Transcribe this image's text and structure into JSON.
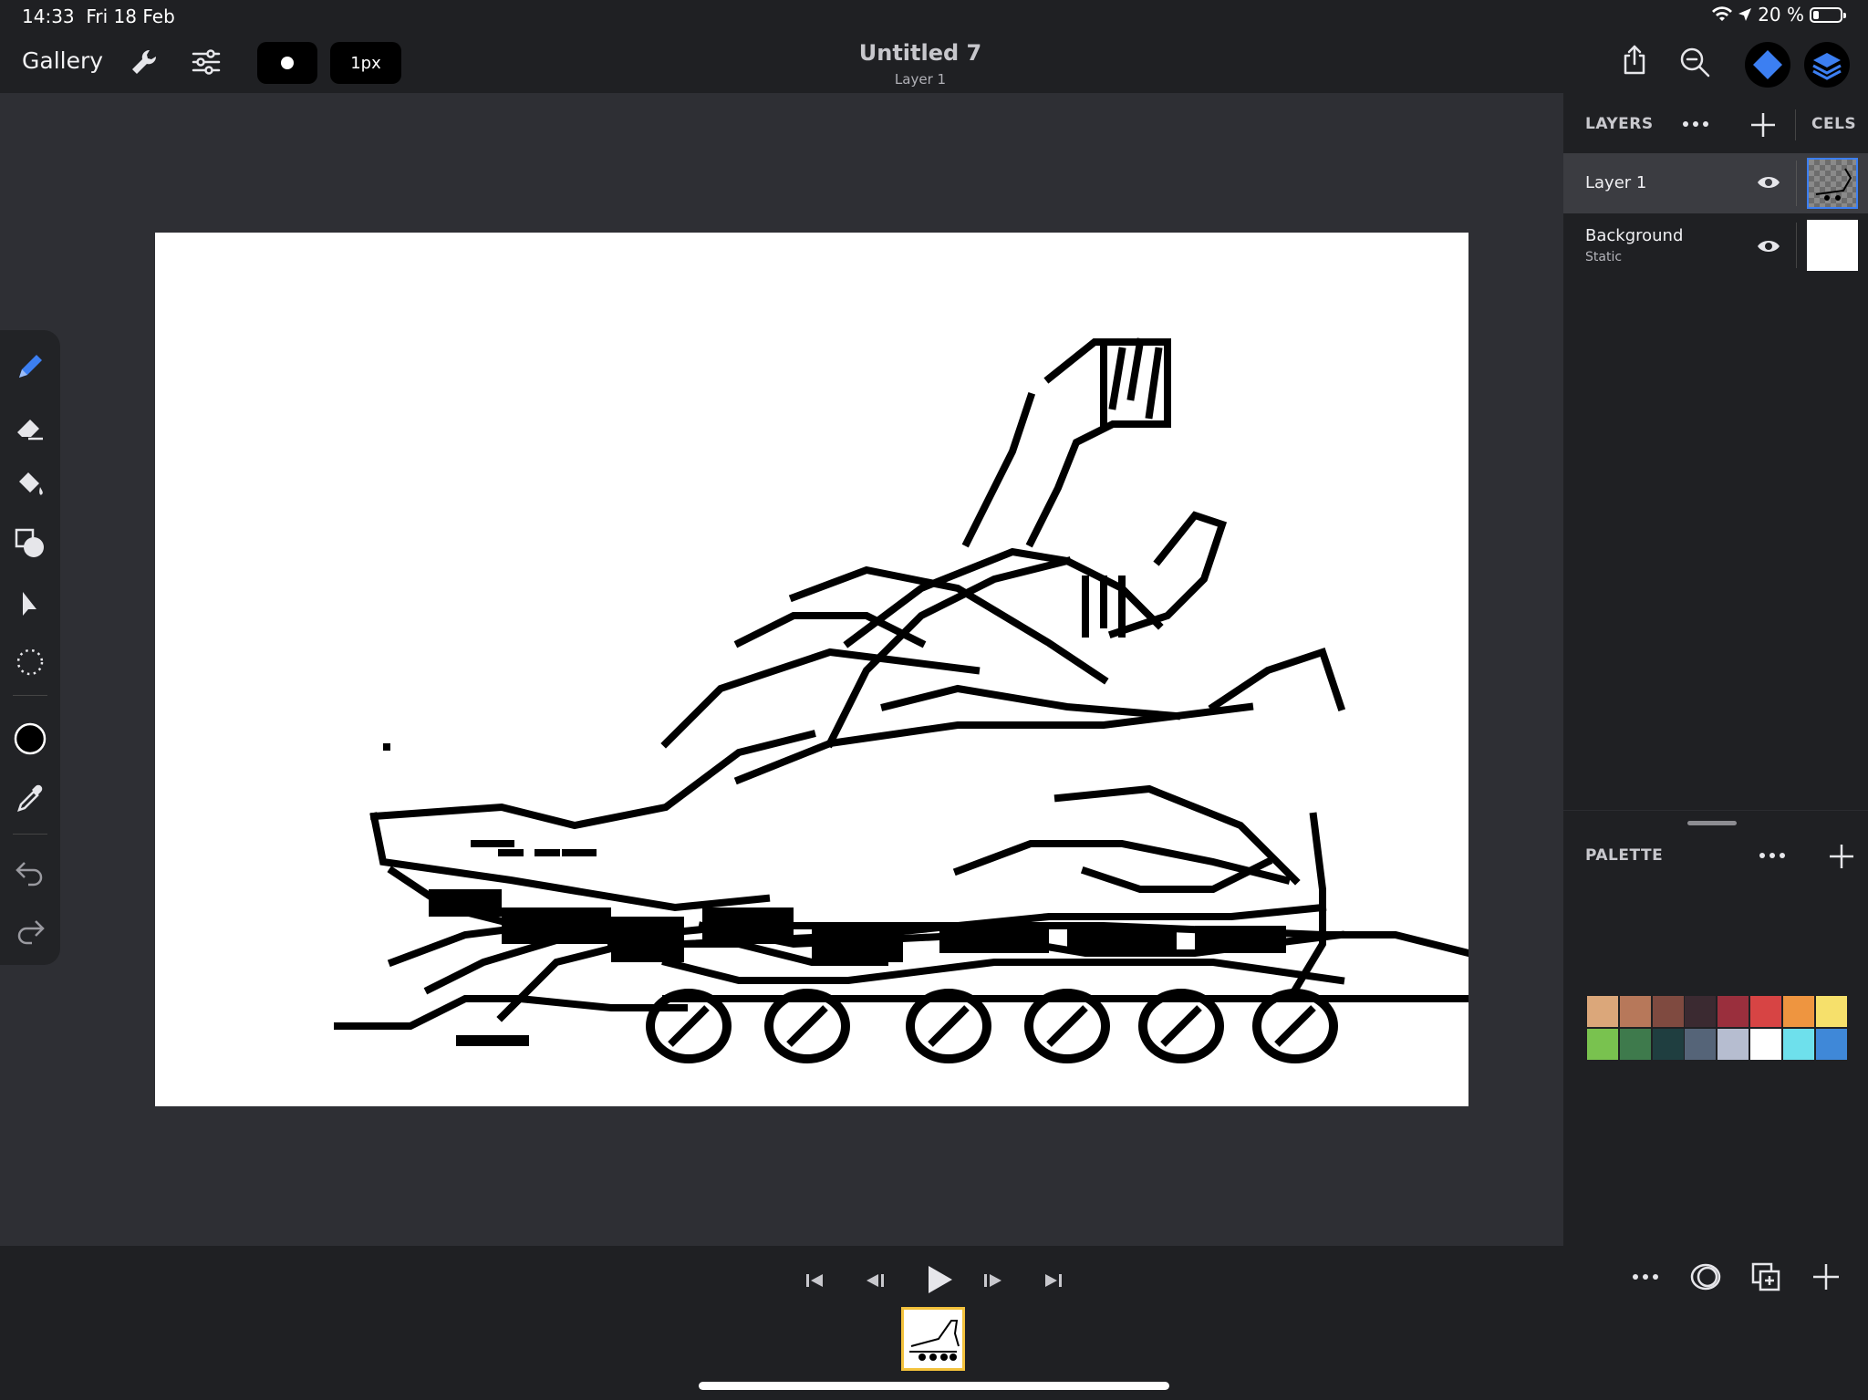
{
  "status": {
    "time": "14:33",
    "date": "Fri 18 Feb",
    "battery": "20 %",
    "battery_level": 0.2
  },
  "toolbar": {
    "gallery": "Gallery",
    "brush_size": "1px"
  },
  "document": {
    "title": "Untitled 7",
    "current_layer": "Layer 1"
  },
  "layers_panel": {
    "title": "LAYERS",
    "cels_title": "CELS",
    "layers": [
      {
        "name": "Layer 1",
        "sub": "",
        "visible": true,
        "selected": true
      },
      {
        "name": "Background",
        "sub": "Static",
        "visible": true,
        "selected": false
      }
    ]
  },
  "palette": {
    "title": "PALETTE",
    "colors": [
      "#dba77a",
      "#b7785a",
      "#7f4a40",
      "#3b2a31",
      "#9a2f3d",
      "#d74444",
      "#ee9540",
      "#f6e06b",
      "#79c24f",
      "#3e7a4c",
      "#1f3e40",
      "#556478",
      "#b6bdd0",
      "#ffffff",
      "#6ee0ec",
      "#3f88d8"
    ]
  },
  "tools": [
    "pencil-icon",
    "eraser-icon",
    "fill-bucket-icon",
    "shapes-icon",
    "select-arrow-icon",
    "lasso-select-icon",
    "color-circle-icon",
    "eyedropper-icon",
    "undo-icon",
    "redo-icon"
  ],
  "colors": {
    "accent": "#3c7ff2",
    "frame_highlight": "#f3c23c",
    "panel": "#1f2023",
    "workspace": "#2e2f34"
  }
}
